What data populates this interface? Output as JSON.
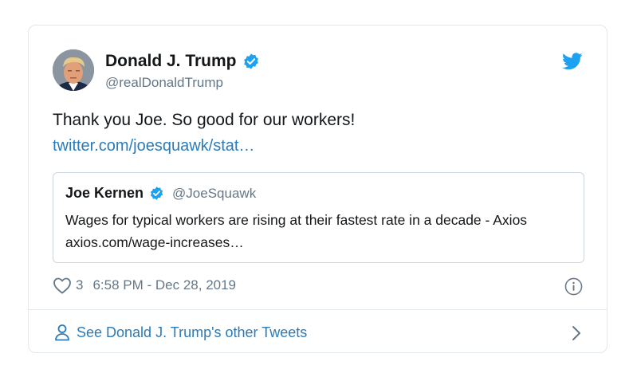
{
  "tweet": {
    "author": {
      "name": "Donald J. Trump",
      "handle": "@realDonaldTrump",
      "verified": true
    },
    "text": "Thank you Joe. So good for our workers!",
    "link": "twitter.com/joesquawk/stat…",
    "quoted": {
      "name": "Joe Kernen",
      "handle": "@JoeSquawk",
      "verified": true,
      "text": "Wages for typical workers are rising at their fastest rate in a decade - Axios axios.com/wage-increases…"
    },
    "likes": "3",
    "timestamp": "6:58 PM - Dec 28, 2019",
    "footer_link": "See Donald J. Trump's other Tweets"
  },
  "icons": {
    "brand": "twitter-bird-icon",
    "verified": "verified-badge-icon",
    "like": "heart-icon",
    "info": "info-icon",
    "profile": "person-icon",
    "chevron": "chevron-right-icon"
  },
  "colors": {
    "brand_blue": "#1da1f2",
    "link_blue": "#2b7bb9",
    "text_primary": "#14171a",
    "text_secondary": "#657786",
    "border": "#e1e8ed"
  }
}
